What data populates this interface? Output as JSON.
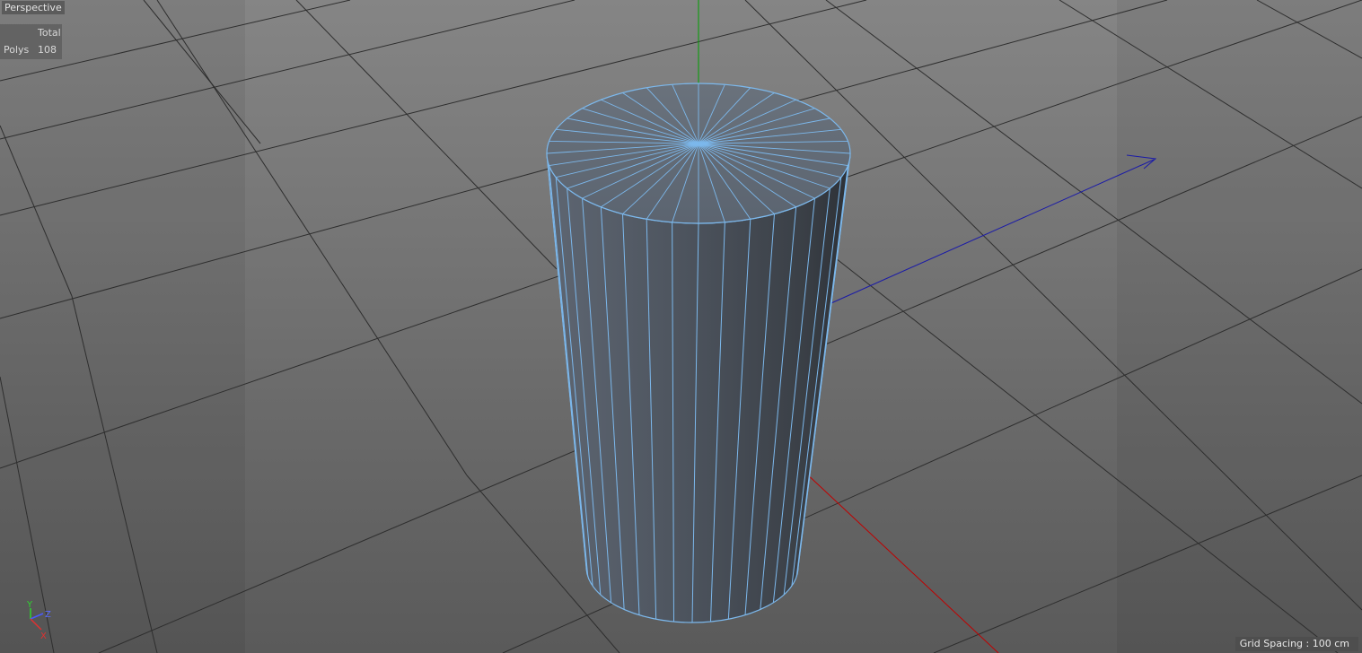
{
  "viewport": {
    "camera_label": "Perspective",
    "stats": {
      "header": "Total",
      "rows": [
        {
          "label": "Polys",
          "value": "108"
        }
      ]
    },
    "grid_spacing": "Grid Spacing : 100 cm",
    "axis_gizmo": {
      "y": "Y",
      "z": "Z",
      "x": "X"
    }
  },
  "colors": {
    "background": "#6a6a6a",
    "grid_line": "#2c2c2c",
    "wireframe": "#7cb8ec",
    "axis_x": "#c00000",
    "axis_y": "#00a000",
    "axis_z": "#1a1aa8"
  },
  "object": {
    "type": "cylinder",
    "segments": 36
  }
}
